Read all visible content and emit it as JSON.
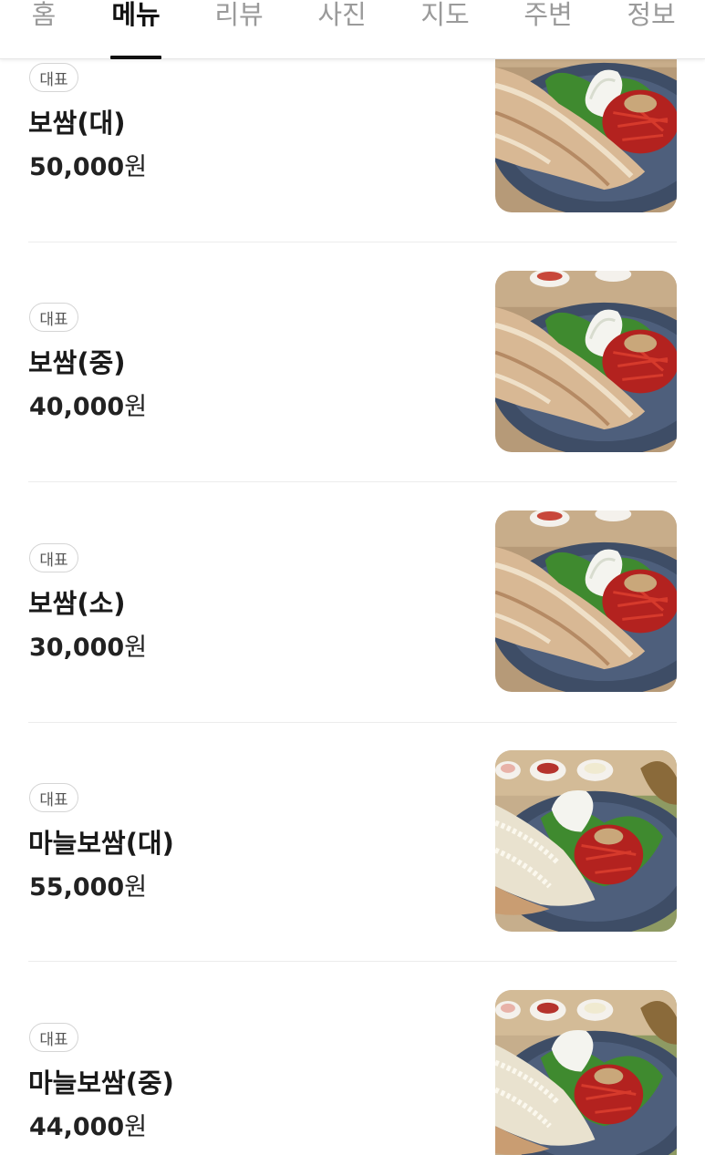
{
  "tabs": [
    {
      "label": "홈",
      "active": false
    },
    {
      "label": "메뉴",
      "active": true
    },
    {
      "label": "리뷰",
      "active": false
    },
    {
      "label": "사진",
      "active": false
    },
    {
      "label": "지도",
      "active": false
    },
    {
      "label": "주변",
      "active": false
    },
    {
      "label": "정보",
      "active": false
    }
  ],
  "menu": {
    "items": [
      {
        "badge": "대표",
        "name": "보쌈(대)",
        "price": "50,000",
        "unit": "원",
        "photo": "bossam-plate-photo"
      },
      {
        "badge": "대표",
        "name": "보쌈(중)",
        "price": "40,000",
        "unit": "원",
        "photo": "bossam-plate-photo"
      },
      {
        "badge": "대표",
        "name": "보쌈(소)",
        "price": "30,000",
        "unit": "원",
        "photo": "bossam-plate-photo"
      },
      {
        "badge": "대표",
        "name": "마늘보쌈(대)",
        "price": "55,000",
        "unit": "원",
        "photo": "garlic-bossam-plate-photo"
      },
      {
        "badge": "대표",
        "name": "마늘보쌈(중)",
        "price": "44,000",
        "unit": "원",
        "photo": "garlic-bossam-plate-photo"
      }
    ]
  },
  "colors": {
    "active_tab": "#111111",
    "inactive_tab": "#9a9a9a",
    "divider": "#ececec",
    "badge_border": "#d5d5d5"
  }
}
